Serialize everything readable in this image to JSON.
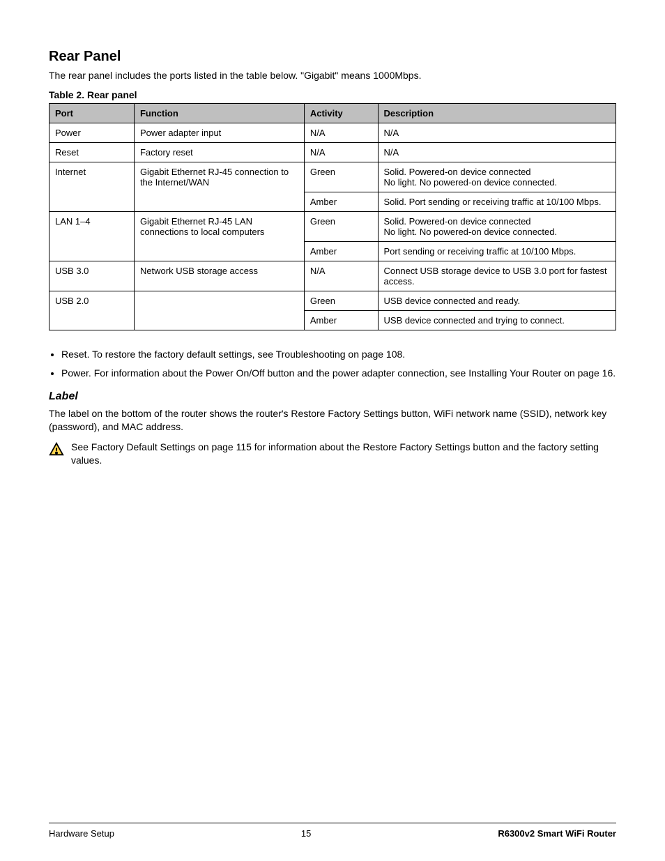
{
  "section_title": "Rear Panel",
  "intro_text": "The rear panel includes the ports listed in the table below. \"Gigabit\" means 1000Mbps.",
  "table_caption": "Table 2. Rear panel",
  "table": {
    "headers": [
      "Port",
      "Function",
      "Activity",
      "Description"
    ],
    "rows": [
      {
        "cells": [
          "Power",
          "Power adapter input",
          "N/A",
          "N/A"
        ],
        "spans": [
          1,
          1,
          1,
          1
        ]
      },
      {
        "cells": [
          "Reset",
          "Factory reset",
          "N/A",
          "N/A"
        ],
        "spans": [
          1,
          1,
          1,
          1
        ]
      },
      {
        "mergeFirstTwo": true,
        "c0": "Internet",
        "c1": "Gigabit Ethernet RJ-45 connection to the Internet/WAN",
        "subrows": [
          [
            "Green",
            "Solid. Powered-on device connected\nNo light. No powered-on device connected."
          ],
          [
            "Amber",
            "Solid. Port sending or receiving traffic at 10/100 Mbps."
          ]
        ]
      },
      {
        "mergeFirstTwo": true,
        "c0": "LAN 1–4",
        "c1": "Gigabit Ethernet RJ-45 LAN connections to local computers",
        "subrows": [
          [
            "Green",
            "Solid. Powered-on device connected\nNo light. No powered-on device connected."
          ],
          [
            "Amber",
            "Port sending or receiving traffic at 10/100 Mbps."
          ]
        ]
      },
      {
        "cells": [
          "USB 3.0",
          "Network USB storage access",
          "N/A",
          "Connect USB storage device to USB 3.0 port for fastest access."
        ],
        "spans": [
          1,
          1,
          1,
          1
        ]
      },
      {
        "mergeFirstTwo": true,
        "c0": "USB 2.0",
        "c1": "",
        "subrows": [
          [
            "Green",
            "USB device connected and ready."
          ],
          [
            "Amber",
            "USB device connected and trying to connect."
          ]
        ]
      }
    ]
  },
  "bullets": [
    "Reset. To restore the factory default settings, see Troubleshooting on page 108.",
    "Power. For information about the Power On/Off button and the power adapter connection, see Installing Your Router on page 16."
  ],
  "label_heading": "Label",
  "label_text": "The label on the bottom of the router shows the router's Restore Factory Settings button, WiFi network name (SSID), network key (password), and MAC address.",
  "warning_text": "See Factory Default Settings on page 115 for information about the Restore Factory Settings button and the factory setting values.",
  "footer": {
    "left": "Hardware Setup",
    "center": "15",
    "right": "R6300v2 Smart WiFi Router"
  }
}
